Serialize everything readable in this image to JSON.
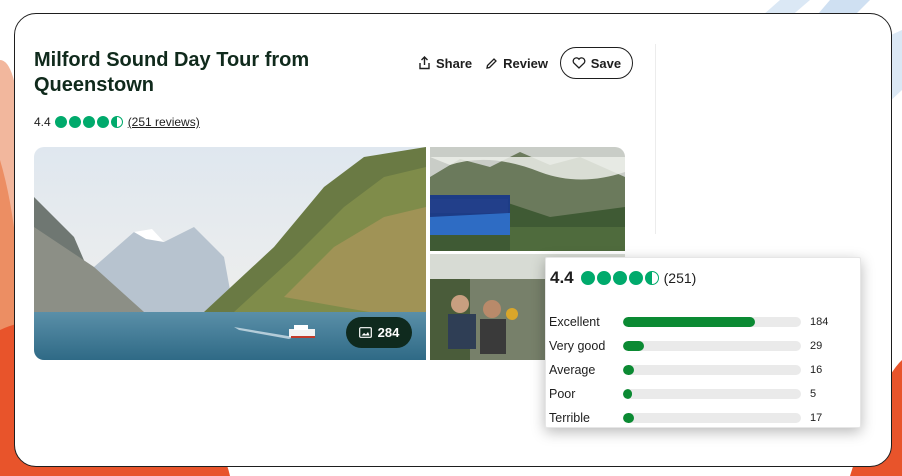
{
  "listing": {
    "title": "Milford Sound Day Tour from Queenstown",
    "rating": "4.4",
    "rating_value": 4.5,
    "reviews_link": "(251 reviews)"
  },
  "actions": {
    "share_label": "Share",
    "review_label": "Review",
    "save_label": "Save",
    "share_icon": "share-icon",
    "review_icon": "pencil-icon",
    "save_icon": "heart-icon"
  },
  "photos": {
    "count": "284",
    "count_icon": "image-icon",
    "main_alt": "Milford Sound fjord with boat",
    "top_alt": "Tour coach in mountains",
    "bottom_alt": "Passengers on coach"
  },
  "rating_popup": {
    "rating": "4.4",
    "count": "(251)",
    "bars": [
      {
        "label": "Excellent",
        "count": "184",
        "fraction": 0.74
      },
      {
        "label": "Very good",
        "count": "29",
        "fraction": 0.12
      },
      {
        "label": "Average",
        "count": "16",
        "fraction": 0.06
      },
      {
        "label": "Poor",
        "count": "5",
        "fraction": 0.05
      },
      {
        "label": "Terrible",
        "count": "17",
        "fraction": 0.06
      }
    ]
  },
  "colors": {
    "accent": "#00aa6c",
    "bar_fill": "#0b8a33",
    "dark_green": "#0f2a1e",
    "decor_orange": "#e8542b",
    "decor_blue": "#cfe0f2"
  }
}
